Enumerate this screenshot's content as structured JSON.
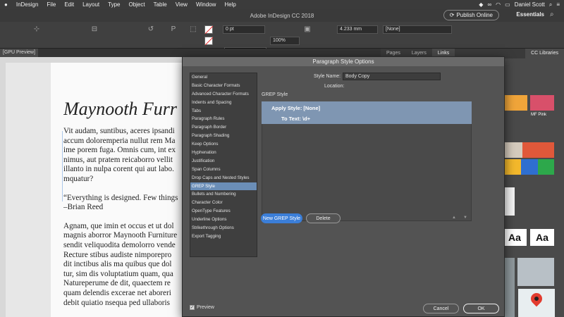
{
  "menubar": {
    "items": [
      "InDesign",
      "File",
      "Edit",
      "Layout",
      "Type",
      "Object",
      "Table",
      "View",
      "Window",
      "Help"
    ],
    "user": "Daniel Scott"
  },
  "app": {
    "title": "Adobe InDesign CC 2018",
    "publish_label": "Publish Online",
    "workspace": "Essentials"
  },
  "control_panel": {
    "stroke_weight": "0 pt",
    "scale": "100%",
    "dimension": "4.233 mm",
    "style": "[None]"
  },
  "document": {
    "tab_label": "[GPU Preview]",
    "heading": "Maynooth Furr",
    "para1": [
      "Vit audam, suntibus, aceres ipsandi",
      "accum doloremperia nullut rem Ma",
      "ime porem fuga. Omnis cum, int ex",
      "nimus, aut pratem reicaborro vellit",
      "illanto in nulpa corent qui aut labo.",
      "mquatur?"
    ],
    "para2": [
      "“Everything is designed. Few things",
      "–Brian Reed"
    ],
    "para3": [
      "Agnam, que imin et occus et ut dol",
      "magnis aborror Maynooth Furniture",
      "sendit veliquodita demolorro vende",
      "Recture stibus audiste nimporepro",
      "dit inctibus alis ma quibus que dol",
      "tur, sim dis voluptatium quam, qua",
      "Natureperume de dit, quaectem re",
      "quam delendis excerae net aboreri",
      "debit quiatio nsequa ped ullaboris"
    ]
  },
  "panels": {
    "tabs": [
      "Pages",
      "Layers",
      "Links"
    ],
    "active_tab": "Links",
    "cc_tab": "CC Libraries",
    "swatch_label": "MF Pink",
    "aa_label": "Aa"
  },
  "dialog": {
    "title": "Paragraph Style Options",
    "style_name_label": "Style Name:",
    "style_name_value": "Body Copy",
    "location_label": "Location:",
    "section_title": "GREP Style",
    "nav": [
      "General",
      "Basic Character Formats",
      "Advanced Character Formats",
      "Indents and Spacing",
      "Tabs",
      "Paragraph Rules",
      "Paragraph Border",
      "Paragraph Shading",
      "Keep Options",
      "Hyphenation",
      "Justification",
      "Span Columns",
      "Drop Caps and Nested Styles",
      "GREP Style",
      "Bullets and Numbering",
      "Character Color",
      "OpenType Features",
      "Underline Options",
      "Strikethrough Options",
      "Export Tagging"
    ],
    "selected_nav": "GREP Style",
    "grep": {
      "apply_style": "Apply Style: [None]",
      "to_text": "To Text: \\d+"
    },
    "new_grep_label": "New GREP Style",
    "delete_label": "Delete",
    "preview_label": "Preview",
    "cancel_label": "Cancel",
    "ok_label": "OK"
  },
  "colors": {
    "accent_blue": "#3b7ed8",
    "selection_blue": "#6b8eb7",
    "swatch_orange": "#f0a53a",
    "swatch_pink": "#d8506a",
    "swatch_red": "#e0583a",
    "swatch_green": "#2da84b",
    "swatch_yellow": "#f3b82c",
    "swatch_blue": "#2f6fd0"
  }
}
